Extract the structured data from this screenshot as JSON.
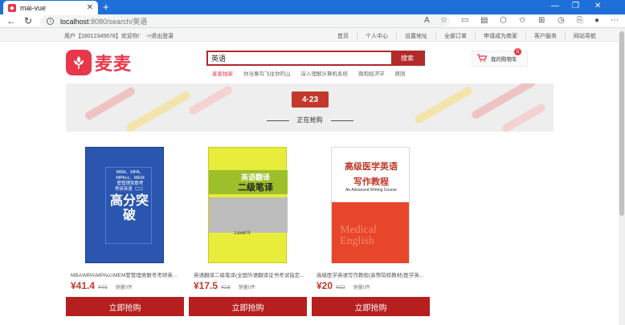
{
  "browser": {
    "tab_title": "mai-vue",
    "url_host": "localhost",
    "url_path": ":8080/search/英语"
  },
  "topnav": {
    "user_text": "用户【18012345678】欢迎你!",
    "logout": "->退出登录",
    "links": [
      "首页",
      "个人中心",
      "设置地址",
      "全部订单",
      "申请成为商家",
      "客户服务",
      "网站导航"
    ]
  },
  "header": {
    "logo_text": "麦麦",
    "search_value": "英语",
    "search_button": "搜索",
    "hotwords": [
      "麦麦独家",
      "你当像鸟飞往你的山",
      "深入理解计算机系统",
      "微观经济学",
      "原则"
    ],
    "cart_label": "我的购物车",
    "cart_count": "0"
  },
  "banner": {
    "badge": "4·23",
    "title": "正在抢购"
  },
  "products": [
    {
      "name": "MBA\\MPA\\MPAcc\\MEM管管理类联考考研英...",
      "price": "¥41.4",
      "old_price": "¥46",
      "sales": "销量0件",
      "button": "立即抢购",
      "cover_lines": [
        "MBA、MPA、",
        "MPAcc、MEM",
        "管管理类联考",
        "考研英语（二）"
      ],
      "cover_big": "高分突破"
    },
    {
      "name": "英语翻译二级笔译(全国外语翻译证书考试指定...",
      "price": "¥17.5",
      "old_price": "¥19",
      "sales": "销量0件",
      "button": "立即抢购",
      "cover_lines": [
        "英语翻译",
        "二级笔译"
      ],
      "cover_level": "Level II"
    },
    {
      "name": "高级医学英语写作教程(高等院校教材)医学英...",
      "price": "¥20",
      "old_price": "¥22",
      "sales": "销量0件",
      "button": "立即抢购",
      "cover_lines": [
        "高级医学英语",
        "写作教程",
        "An Advanced Writing Course"
      ],
      "cover_watermark": "Medical English"
    }
  ]
}
